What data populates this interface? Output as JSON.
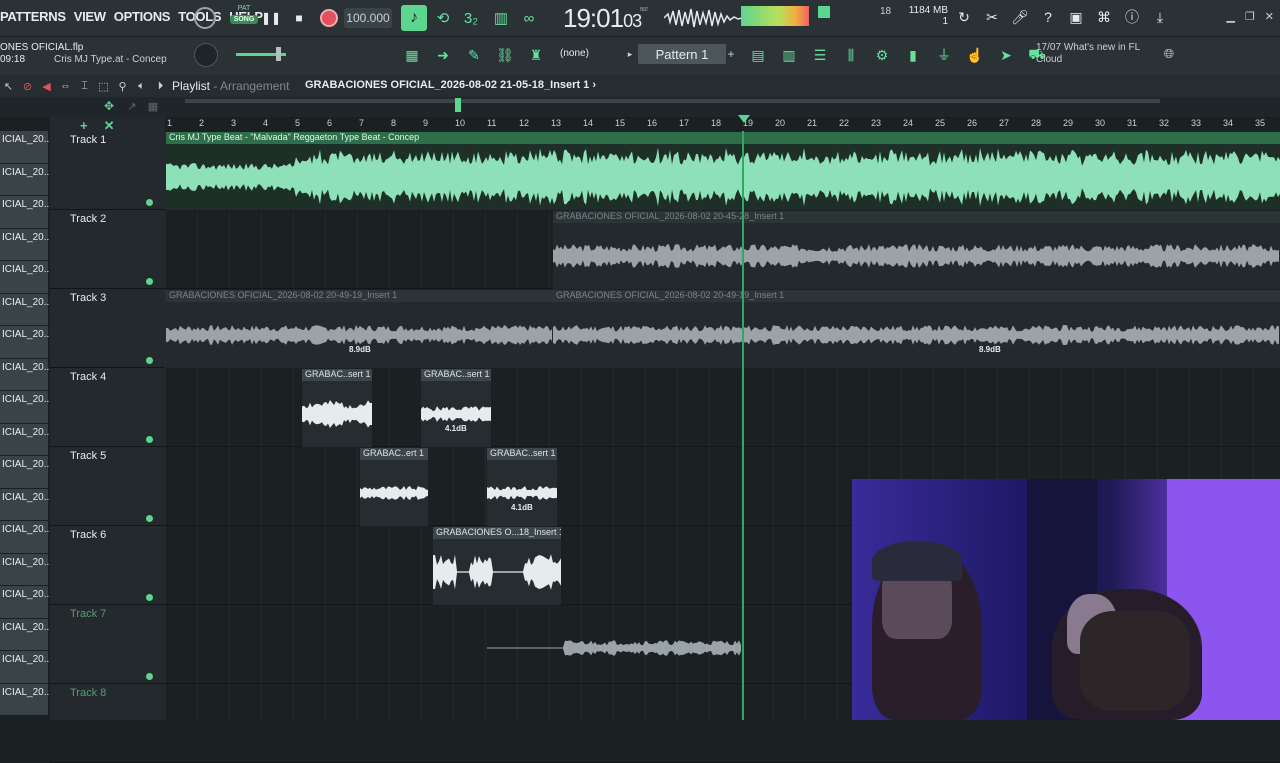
{
  "menu": [
    "PATTERNS",
    "VIEW",
    "OPTIONS",
    "TOOLS",
    "HELP"
  ],
  "pat_song": {
    "pat": "PAT",
    "song": "SONG"
  },
  "tempo": "100.000",
  "clock": {
    "main": "19:01",
    "sub": "03",
    "unit": "B:S:T"
  },
  "cpu": {
    "value": "18",
    "voices": "1"
  },
  "memory": "1184 MB",
  "project": {
    "file": "ONES OFICIAL.flp",
    "time": "09:18",
    "hint": "Cris MJ Type.at - Concep"
  },
  "channel_selector": "(none)",
  "pattern": "Pattern 1",
  "news": {
    "date": "17/07",
    "text": "What's new in FL",
    "line2": "Cloud"
  },
  "playlist": {
    "title": "Playlist",
    "sep": " - ",
    "mode": "Arrangement",
    "path": "GRABACIONES OFICIAL_2026-08-02 21-05-18_Insert 1",
    "arrow": "›"
  },
  "ruler": [
    "1",
    "2",
    "3",
    "4",
    "5",
    "6",
    "7",
    "8",
    "9",
    "10",
    "11",
    "12",
    "13",
    "14",
    "15",
    "16",
    "17",
    "18",
    "19",
    "20",
    "21",
    "22",
    "23",
    "24",
    "25",
    "26",
    "27",
    "28",
    "29",
    "30",
    "31",
    "32",
    "33",
    "34",
    "35"
  ],
  "picker": [
    "ICIAL_20..",
    "ICIAL_20..",
    "ICIAL_20..",
    "ICIAL_20..",
    "ICIAL_20..",
    "ICIAL_20..",
    "ICIAL_20..",
    "ICIAL_20..",
    "ICIAL_20..",
    "ICIAL_20..",
    "ICIAL_20..",
    "ICIAL_20..",
    "ICIAL_20..",
    "ICIAL_20..",
    "ICIAL_20..",
    "ICIAL_20..",
    "ICIAL_20..",
    "ICIAL_20.."
  ],
  "tracks": [
    "Track 1",
    "Track 2",
    "Track 3",
    "Track 4",
    "Track 5",
    "Track 6",
    "Track 7",
    "Track 8"
  ],
  "clips": {
    "t1": "Cris MJ Type Beat - \"Malvada\" Reggaeton Type Beat - Concep",
    "t2": "GRABACIONES OFICIAL_2026-08-02 20-45-28_Insert 1",
    "t3a": "GRABACIONES OFICIAL_2026-08-02 20-49-19_Insert 1",
    "t3b": "GRABACIONES OFICIAL_2026-08-02 20-49-19_Insert 1",
    "t4a": "GRABAC..sert 1",
    "t4b": "GRABAC..sert 1",
    "t5a": "GRABAC..ert 1",
    "t5b": "GRABAC..sert 1",
    "t6": "GRABACIONES O...18_Insert 1"
  },
  "gains": {
    "t3a": "8.9dB",
    "t3b": "8.9dB",
    "t4b": "4.1dB",
    "t5b": "4.1dB"
  },
  "colors": {
    "accent": "#5cd68f",
    "beat_waveform": "#8ee0b8",
    "playhead": "#2fa864",
    "record": "#e0525c"
  }
}
